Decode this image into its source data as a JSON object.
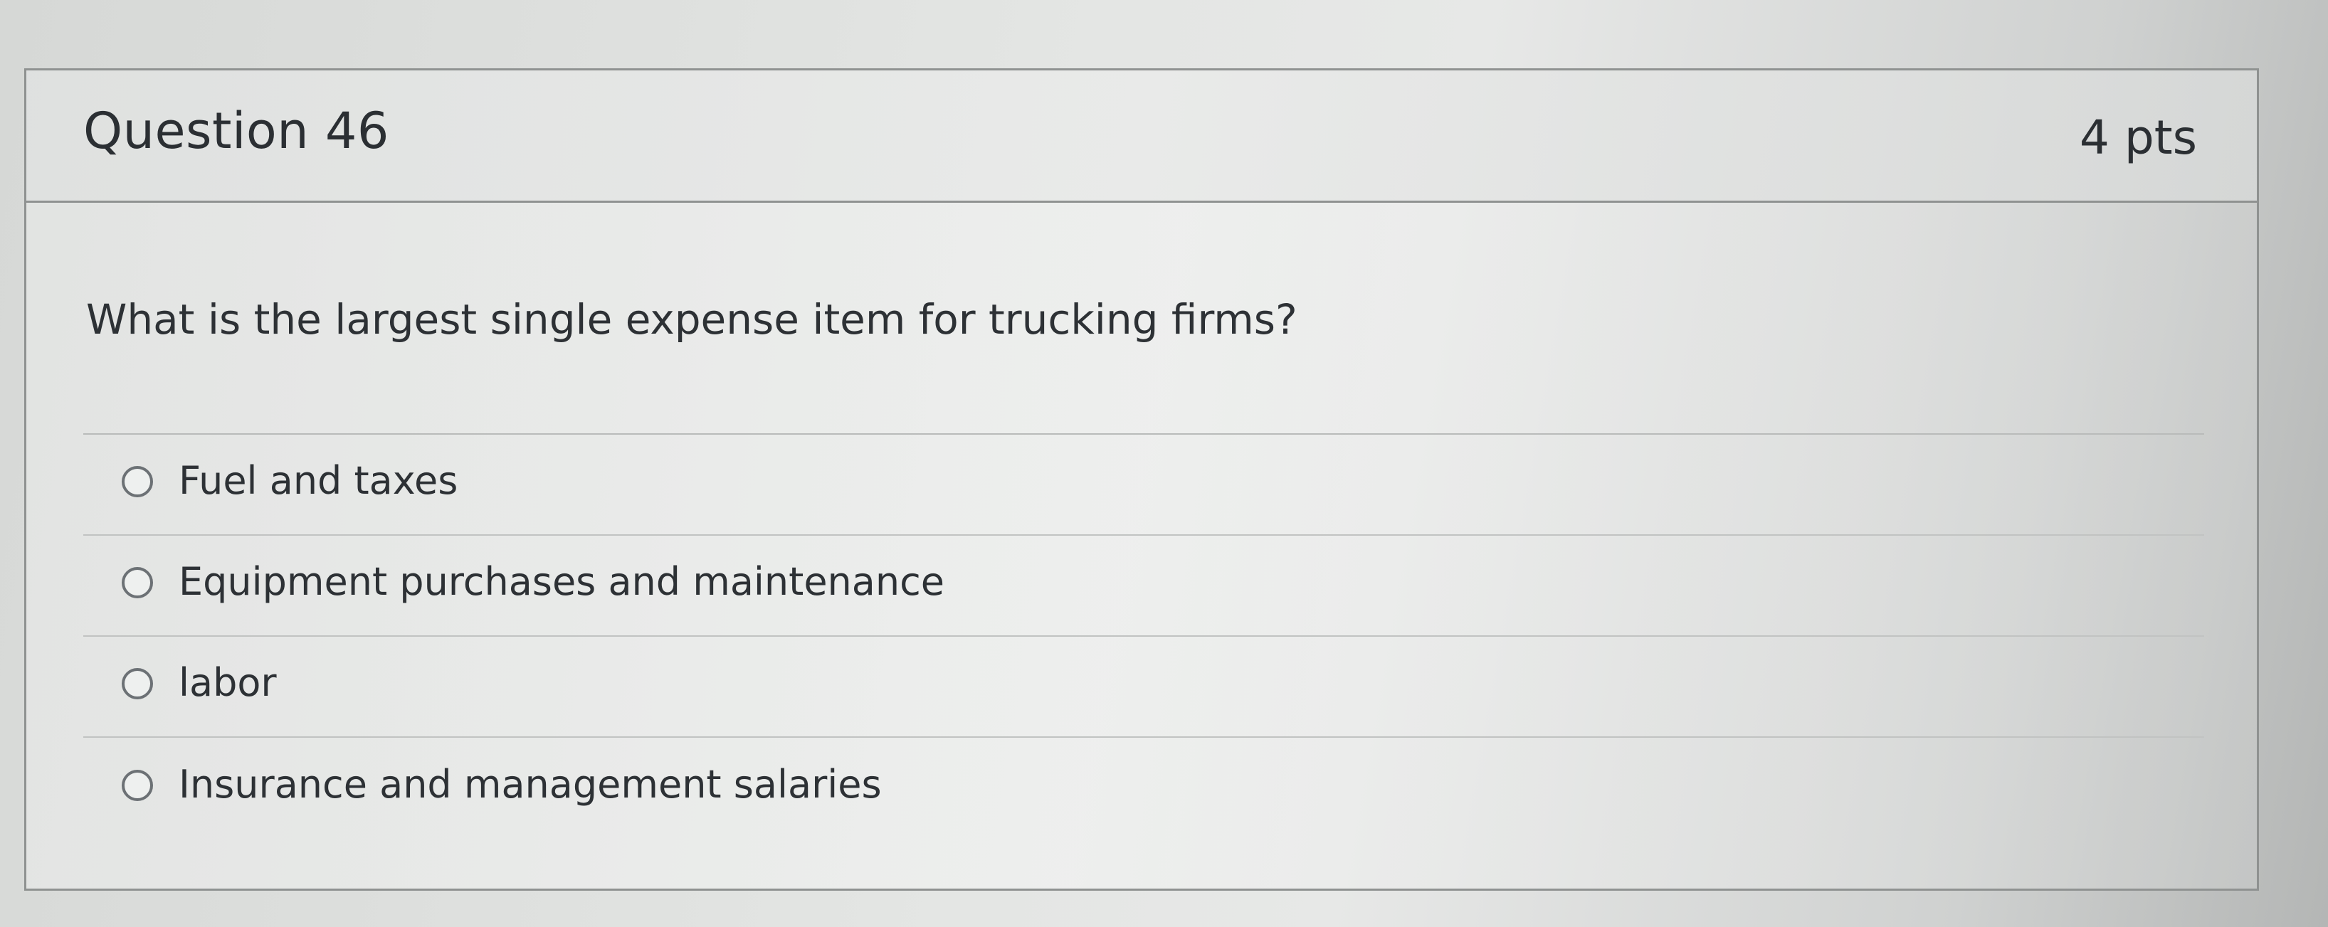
{
  "question": {
    "title": "Question 46",
    "points": "4 pts",
    "prompt": "What is the largest single expense item for trucking firms?",
    "answers": [
      {
        "label": "Fuel and taxes"
      },
      {
        "label": "Equipment purchases and maintenance"
      },
      {
        "label": "labor"
      },
      {
        "label": "Insurance and management salaries"
      }
    ]
  },
  "colors": {
    "text": "#2b2f33",
    "border": "#8f9291",
    "radio_border": "#6c7175"
  }
}
